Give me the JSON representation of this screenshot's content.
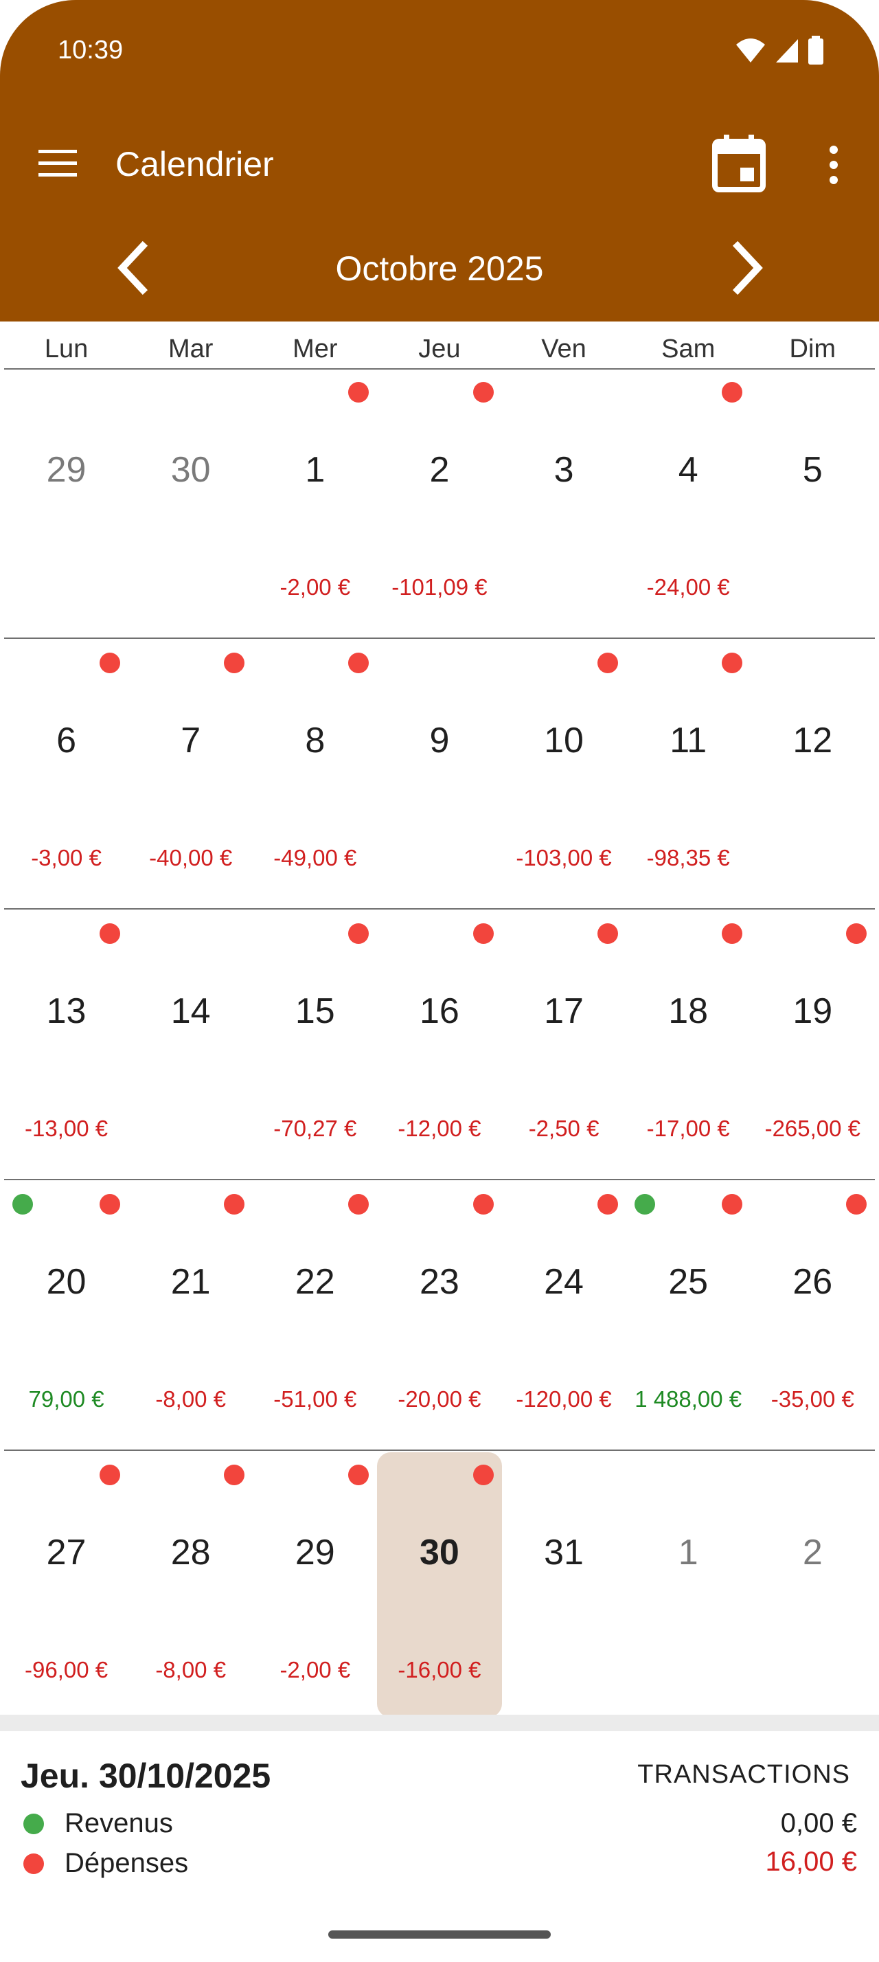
{
  "status_bar": {
    "time": "10:39"
  },
  "toolbar": {
    "title": "Calendrier"
  },
  "month_nav": {
    "label": "Octobre 2025"
  },
  "weekdays": [
    "Lun",
    "Mar",
    "Mer",
    "Jeu",
    "Ven",
    "Sam",
    "Dim"
  ],
  "weeks": [
    [
      {
        "day": "29",
        "muted": true
      },
      {
        "day": "30",
        "muted": true
      },
      {
        "day": "1",
        "expense_dot": true,
        "amount": "-2,00 €"
      },
      {
        "day": "2",
        "expense_dot": true,
        "amount": "-101,09 €"
      },
      {
        "day": "3"
      },
      {
        "day": "4",
        "expense_dot": true,
        "amount": "-24,00 €"
      },
      {
        "day": "5"
      }
    ],
    [
      {
        "day": "6",
        "expense_dot": true,
        "amount": "-3,00 €"
      },
      {
        "day": "7",
        "expense_dot": true,
        "amount": "-40,00 €"
      },
      {
        "day": "8",
        "expense_dot": true,
        "amount": "-49,00 €"
      },
      {
        "day": "9"
      },
      {
        "day": "10",
        "expense_dot": true,
        "amount": "-103,00 €"
      },
      {
        "day": "11",
        "expense_dot": true,
        "amount": "-98,35 €"
      },
      {
        "day": "12"
      }
    ],
    [
      {
        "day": "13",
        "expense_dot": true,
        "amount": "-13,00 €"
      },
      {
        "day": "14"
      },
      {
        "day": "15",
        "expense_dot": true,
        "amount": "-70,27 €"
      },
      {
        "day": "16",
        "expense_dot": true,
        "amount": "-12,00 €"
      },
      {
        "day": "17",
        "expense_dot": true,
        "amount": "-2,50 €"
      },
      {
        "day": "18",
        "expense_dot": true,
        "amount": "-17,00 €"
      },
      {
        "day": "19",
        "expense_dot": true,
        "amount": "-265,00 €"
      }
    ],
    [
      {
        "day": "20",
        "income_dot": true,
        "expense_dot": true,
        "amount": "79,00 €",
        "positive": true
      },
      {
        "day": "21",
        "expense_dot": true,
        "amount": "-8,00 €"
      },
      {
        "day": "22",
        "expense_dot": true,
        "amount": "-51,00 €"
      },
      {
        "day": "23",
        "expense_dot": true,
        "amount": "-20,00 €"
      },
      {
        "day": "24",
        "expense_dot": true,
        "amount": "-120,00 €"
      },
      {
        "day": "25",
        "income_dot": true,
        "expense_dot": true,
        "amount": "1 488,00 €",
        "positive": true
      },
      {
        "day": "26",
        "expense_dot": true,
        "amount": "-35,00 €"
      }
    ],
    [
      {
        "day": "27",
        "expense_dot": true,
        "amount": "-96,00 €"
      },
      {
        "day": "28",
        "expense_dot": true,
        "amount": "-8,00 €"
      },
      {
        "day": "29",
        "expense_dot": true,
        "amount": "-2,00 €"
      },
      {
        "day": "30",
        "expense_dot": true,
        "amount": "-16,00 €",
        "selected": true
      },
      {
        "day": "31"
      },
      {
        "day": "1",
        "muted": true
      },
      {
        "day": "2",
        "muted": true
      }
    ]
  ],
  "summary": {
    "date": "Jeu. 30/10/2025",
    "transactions_label": "TRANSACTIONS",
    "income_label": "Revenus",
    "income_value": "0,00 €",
    "expense_label": "Dépenses",
    "expense_value": "16,00 €"
  },
  "colors": {
    "app_bar": "#994e00",
    "expense": "#f2453d",
    "income": "#45ab4b",
    "selected_day": "#e8d9cc"
  }
}
